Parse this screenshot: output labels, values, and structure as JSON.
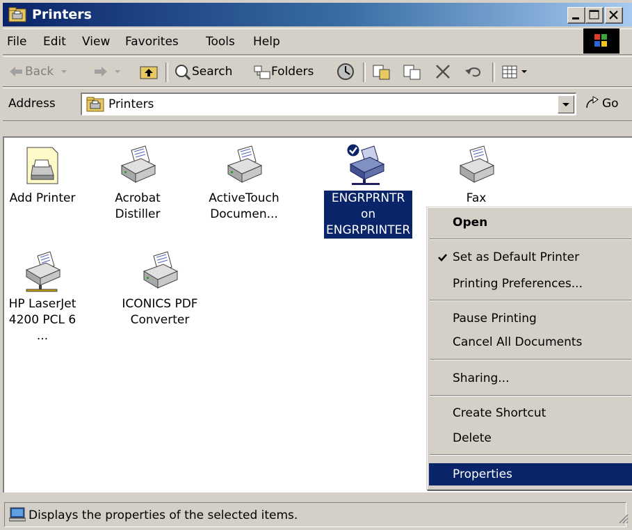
{
  "window": {
    "title": "Printers",
    "title_icon": "printers-folder-icon"
  },
  "menubar": {
    "items": [
      "File",
      "Edit",
      "View",
      "Favorites",
      "Tools",
      "Help"
    ]
  },
  "toolbar": {
    "back_label": "Back",
    "search_label": "Search",
    "folders_label": "Folders"
  },
  "address": {
    "label": "Address",
    "value": "Printers",
    "go_label": "Go"
  },
  "items": [
    {
      "label_lines": [
        "Add Printer"
      ],
      "icon": "add-printer-icon"
    },
    {
      "label_lines": [
        "Acrobat",
        "Distiller"
      ],
      "icon": "printer-icon"
    },
    {
      "label_lines": [
        "ActiveTouch",
        "Documen..."
      ],
      "icon": "printer-icon"
    },
    {
      "label_lines": [
        "ENGRPRNTR",
        "on",
        "ENGRPRINTER"
      ],
      "icon": "network-default-printer-icon",
      "selected": true
    },
    {
      "label_lines": [
        "Fax"
      ],
      "icon": "fax-printer-icon"
    },
    {
      "label_lines": [
        "HP LaserJet",
        "4200 PCL 6 ..."
      ],
      "icon": "network-printer-icon"
    },
    {
      "label_lines": [
        "ICONICS PDF",
        "Converter"
      ],
      "icon": "printer-icon"
    }
  ],
  "context_menu": {
    "open": "Open",
    "set_default": "Set as Default Printer",
    "printing_prefs": "Printing Preferences...",
    "pause": "Pause Printing",
    "cancel_all": "Cancel All Documents",
    "sharing": "Sharing...",
    "create_shortcut": "Create Shortcut",
    "delete": "Delete",
    "properties": "Properties"
  },
  "status": {
    "text": "Displays the properties of the selected items.",
    "icon": "computer-icon"
  },
  "colors": {
    "selection": "#0a246a",
    "face": "#d4d0c8",
    "title_start": "#0a246a",
    "title_end": "#a6caf0"
  }
}
